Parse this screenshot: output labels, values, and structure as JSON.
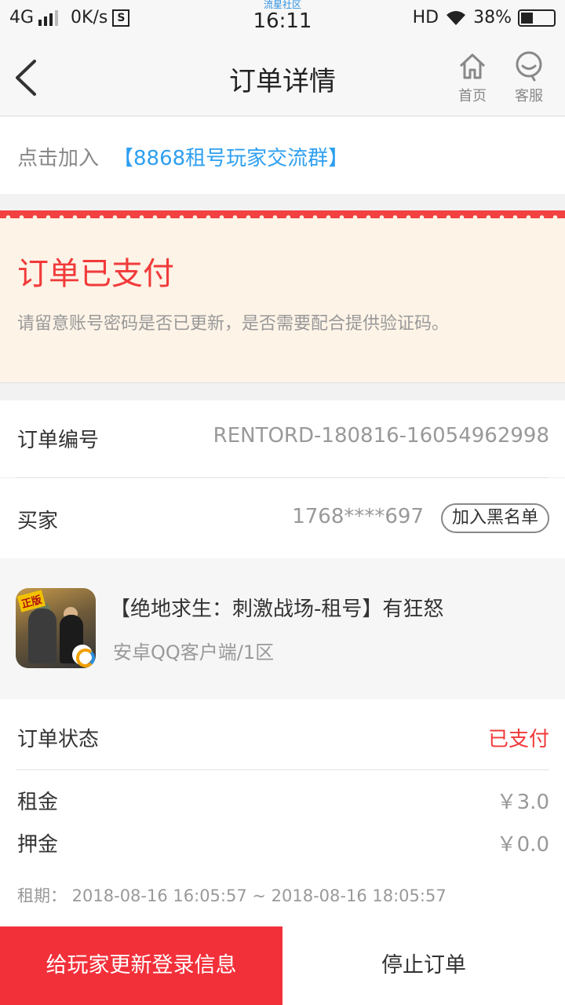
{
  "status_bar": {
    "network": "4G",
    "speed": "0K/s",
    "notification_glyph": "S",
    "app_name": "流星社区",
    "time": "16:11",
    "hd": "HD",
    "battery": "38%",
    "battery_level": 0.38
  },
  "header": {
    "title": "订单详情",
    "home_label": "首页",
    "service_label": "客服"
  },
  "group": {
    "prefix": "点击加入",
    "link": "【8868租号玩家交流群】"
  },
  "banner": {
    "title": "订单已支付",
    "description": "请留意账号密码是否已更新，是否需要配合提供验证码。",
    "colors": {
      "accent": "#f13a3a",
      "background": "#fdf3e7"
    }
  },
  "order": {
    "number_label": "订单编号",
    "number_value": "RENTORD-180816-16054962998",
    "buyer_label": "买家",
    "buyer_value": "1768****697",
    "blacklist_button": "加入黑名单"
  },
  "game": {
    "icon_badge": "正版",
    "title": "【绝地求生：刺激战场-租号】有狂怒",
    "subtitle": "安卓QQ客户端/1区"
  },
  "details": {
    "status_label": "订单状态",
    "status_value": "已支付",
    "rent_label": "租金",
    "rent_value": "￥3.0",
    "deposit_label": "押金",
    "deposit_value": "￥0.0",
    "period": "租期：   2018-08-16 16:05:57 ~ 2018-08-16 18:05:57"
  },
  "bottom_bar": {
    "update_button": "给玩家更新登录信息",
    "stop_button": "停止订单"
  }
}
